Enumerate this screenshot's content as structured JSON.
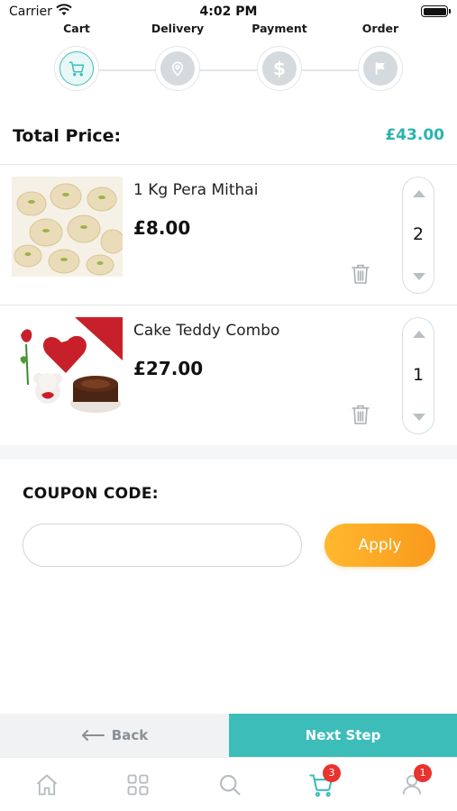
{
  "status_bar": {
    "carrier": "Carrier",
    "time": "4:02 PM"
  },
  "stepper": {
    "steps": [
      {
        "label": "Cart",
        "icon": "cart-icon",
        "active": true
      },
      {
        "label": "Delivery",
        "icon": "location-pin-icon",
        "active": false
      },
      {
        "label": "Payment",
        "icon": "dollar-icon",
        "active": false
      },
      {
        "label": "Order",
        "icon": "flag-icon",
        "active": false
      }
    ]
  },
  "total": {
    "label": "Total Price:",
    "value": "£43.00"
  },
  "cart": {
    "items": [
      {
        "name": "1 Kg Pera Mithai",
        "price": "£8.00",
        "quantity": "2",
        "image": "pera-mithai-photo"
      },
      {
        "name": "Cake Teddy Combo",
        "price": "£27.00",
        "quantity": "1",
        "image": "cake-teddy-combo-photo"
      }
    ]
  },
  "coupon": {
    "title": "COUPON CODE:",
    "value": "",
    "placeholder": "",
    "apply_label": "Apply"
  },
  "actions": {
    "back_label": "Back",
    "next_label": "Next Step"
  },
  "tab_bar": {
    "tabs": [
      {
        "icon": "home-icon"
      },
      {
        "icon": "grid-icon"
      },
      {
        "icon": "search-icon"
      },
      {
        "icon": "cart-icon",
        "badge": "3",
        "active": true
      },
      {
        "icon": "user-icon",
        "badge": "1"
      }
    ]
  },
  "colors": {
    "accent": "#3dbdba",
    "price_accent": "#2ab3b0",
    "apply_start": "#ffb82e",
    "apply_end": "#f99a1c",
    "badge": "#e8332e"
  }
}
